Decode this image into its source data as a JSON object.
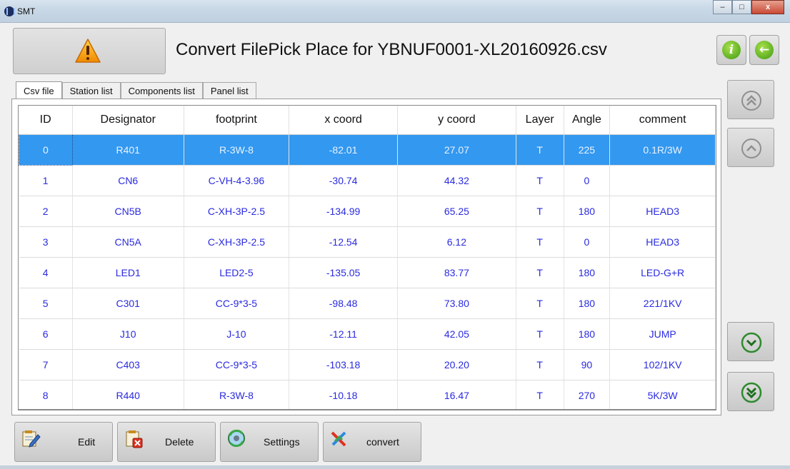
{
  "window": {
    "title": "SMT",
    "minimize_label": "–",
    "maximize_label": "□",
    "close_label": "x"
  },
  "header": {
    "title": "Convert FilePick Place for YBNUF0001-XL20160926.csv",
    "warning_icon": "warning-triangle-icon",
    "info_icon": "info-icon",
    "back_icon": "back-arrow-icon",
    "info_label": "i",
    "back_label": "←"
  },
  "tabs": [
    {
      "label": "Csv file",
      "active": true
    },
    {
      "label": "Station list",
      "active": false
    },
    {
      "label": "Components list",
      "active": false
    },
    {
      "label": "Panel list",
      "active": false
    }
  ],
  "table": {
    "columns": [
      "ID",
      "Designator",
      "footprint",
      "x coord",
      "y coord",
      "Layer",
      "Angle",
      "comment"
    ],
    "selected_row": 0,
    "rows": [
      [
        "0",
        "R401",
        "R-3W-8",
        "-82.01",
        "27.07",
        "T",
        "225",
        "0.1R/3W"
      ],
      [
        "1",
        "CN6",
        "C-VH-4-3.96",
        "-30.74",
        "44.32",
        "T",
        "0",
        ""
      ],
      [
        "2",
        "CN5B",
        "C-XH-3P-2.5",
        "-134.99",
        "65.25",
        "T",
        "180",
        "HEAD3"
      ],
      [
        "3",
        "CN5A",
        "C-XH-3P-2.5",
        "-12.54",
        "6.12",
        "T",
        "0",
        "HEAD3"
      ],
      [
        "4",
        "LED1",
        "LED2-5",
        "-135.05",
        "83.77",
        "T",
        "180",
        "LED-G+R"
      ],
      [
        "5",
        "C301",
        "CC-9*3-5",
        "-98.48",
        "73.80",
        "T",
        "180",
        "221/1KV"
      ],
      [
        "6",
        "J10",
        "J-10",
        "-12.11",
        "42.05",
        "T",
        "180",
        "JUMP"
      ],
      [
        "7",
        "C403",
        "CC-9*3-5",
        "-103.18",
        "20.20",
        "T",
        "90",
        "102/1KV"
      ],
      [
        "8",
        "R440",
        "R-3W-8",
        "-10.18",
        "16.47",
        "T",
        "270",
        "5K/3W"
      ]
    ]
  },
  "nav": {
    "first_icon": "double-chevron-up-icon",
    "prev_icon": "chevron-up-icon",
    "next_icon": "chevron-down-icon",
    "last_icon": "double-chevron-down-icon",
    "up_enabled": false,
    "down_enabled": true
  },
  "bottom_buttons": [
    {
      "label": "Edit",
      "icon": "edit-icon"
    },
    {
      "label": "Delete",
      "icon": "delete-icon"
    },
    {
      "label": "Settings",
      "icon": "settings-icon"
    },
    {
      "label": "convert",
      "icon": "convert-icon"
    }
  ],
  "colors": {
    "selected_row": "#3398f0",
    "cell_text": "#2a2ae0",
    "nav_enabled": "#2e8b2e"
  }
}
